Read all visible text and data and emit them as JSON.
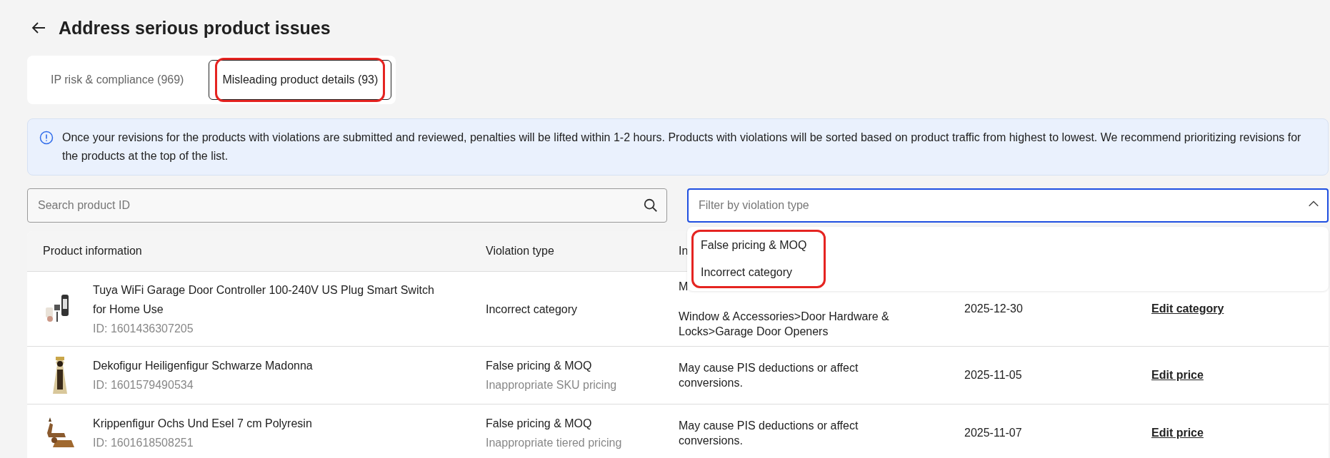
{
  "page": {
    "title": "Address serious product issues"
  },
  "tabs": [
    {
      "label": "IP risk & compliance (969)",
      "selected": false,
      "highlighted": false
    },
    {
      "label": "Misleading product details (93)",
      "selected": true,
      "highlighted": true
    }
  ],
  "notice": "Once your revisions for the products with violations are submitted and reviewed, penalties will be lifted within 1-2 hours. Products with violations will be sorted based on product traffic from highest to lowest. We recommend prioritizing revisions for the products at the top of the list.",
  "search": {
    "placeholder": "Search product ID"
  },
  "filter": {
    "placeholder": "Filter by violation type",
    "expanded": true,
    "highlighted": true,
    "options": [
      "False pricing & MOQ",
      "Incorrect category"
    ]
  },
  "table": {
    "columns": [
      "Product information",
      "Violation type",
      "In"
    ],
    "rows": [
      {
        "name": "Tuya WiFi Garage Door Controller 100-240V US Plug Smart Switch for Home Use",
        "id": "ID: 1601436307205",
        "violation": "Incorrect category",
        "detail": null,
        "impact": [
          "M",
          "Window & Accessories>Door Hardware &",
          "Locks>Garage Door Openers"
        ],
        "partly_covered": true,
        "date": "2025-12-30",
        "action": "Edit category"
      },
      {
        "name": "Dekofigur Heiligenfigur Schwarze Madonna",
        "id": "ID: 1601579490534",
        "violation": "False pricing & MOQ",
        "detail": "Inappropriate SKU pricing",
        "impact": [
          "May cause PIS deductions or affect",
          "conversions."
        ],
        "partly_covered": false,
        "date": "2025-11-05",
        "action": "Edit price"
      },
      {
        "name": "Krippenfigur Ochs Und Esel 7 cm Polyresin",
        "id": "ID: 1601618508251",
        "violation": "False pricing & MOQ",
        "detail": "Inappropriate tiered pricing",
        "impact": [
          "May cause PIS deductions or affect",
          "conversions."
        ],
        "partly_covered": false,
        "date": "2025-11-07",
        "action": "Edit price"
      }
    ]
  }
}
